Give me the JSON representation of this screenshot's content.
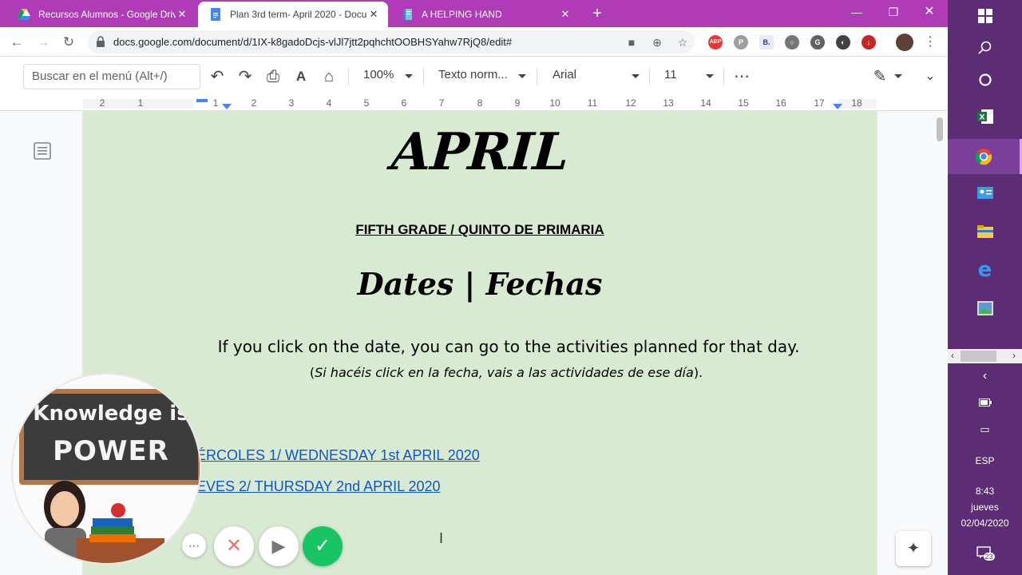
{
  "browser": {
    "tabs": [
      {
        "title": "Recursos Alumnos - Google Drive",
        "icon": "google-drive-icon",
        "active": false
      },
      {
        "title": "Plan 3rd term- April 2020 - Docu",
        "icon": "google-docs-icon",
        "active": true
      },
      {
        "title": "A HELPING HAND",
        "icon": "notebook-icon",
        "active": false
      }
    ],
    "url": "docs.google.com/document/d/1IX-k8gadoDcjs-vlJl7jtt2pqhchtOOBHSYahw7RjQ8/edit#",
    "extensions": [
      "ABP",
      "B."
    ],
    "tab_color": "#b03bb6"
  },
  "docs_toolbar": {
    "menu_search_placeholder": "Buscar en el menú (Alt+/)",
    "zoom": "100%",
    "style": "Texto norm...",
    "font": "Arial",
    "size": "11"
  },
  "ruler": {
    "numbers": [
      "2",
      "1",
      "1",
      "2",
      "3",
      "4",
      "5",
      "6",
      "7",
      "8",
      "9",
      "10",
      "11",
      "12",
      "13",
      "14",
      "15",
      "16",
      "17",
      "18"
    ]
  },
  "document": {
    "page_color": "#d9ead3",
    "heading": "APRIL",
    "grade": "FIFTH GRADE / QUINTO DE PRIMARIA",
    "dates_title": "Dates | Fechas",
    "instruction": "If you click on the date, you can go to the activities planned for that day.",
    "instruction_es_open": "(",
    "instruction_es": "Si hacéis click en la fecha, vais a las actividades de ese día",
    "instruction_es_close": ").",
    "links": [
      "ÉRCOLES 1/ WEDNESDAY 1st  APRIL 2020",
      "EVES 2/ THURSDAY 2nd  APRIL 2020"
    ],
    "link_color": "#1155cc"
  },
  "webcam": {
    "board_line1": "Knowledge is",
    "board_line2": "POWER"
  },
  "taskbar": {
    "lang": "ESP",
    "time": "8:43",
    "day": "jueves",
    "date": "02/04/2020",
    "notifications": "23",
    "color": "#5c2d75"
  }
}
